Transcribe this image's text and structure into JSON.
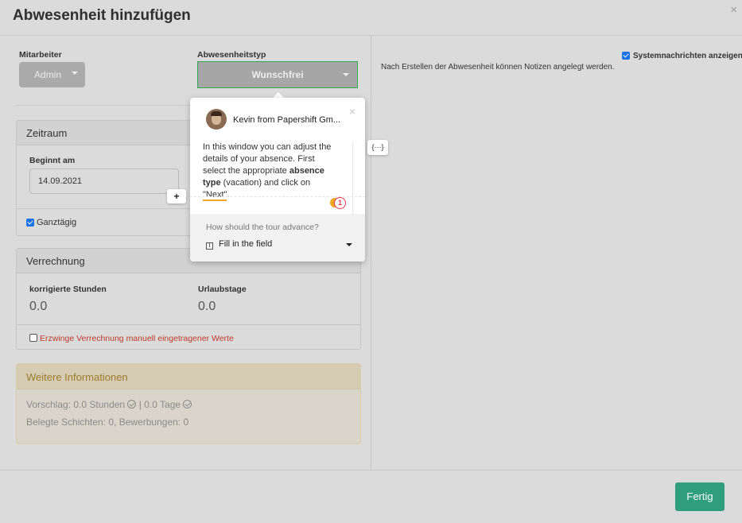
{
  "header": {
    "title": "Abwesenheit hinzufügen",
    "close": "×"
  },
  "left": {
    "employee": {
      "label": "Mitarbeiter",
      "value": "Admin"
    },
    "absence_type": {
      "label": "Abwesenheitstyp",
      "value": "Wunschfrei"
    },
    "zeitraum": {
      "title": "Zeitraum",
      "start_label": "Beginnt am",
      "start_value": "14.09.2021",
      "all_day_label": "Ganztägig",
      "all_day_checked": true
    },
    "verrechnung": {
      "title": "Verrechnung",
      "hours_label": "korrigierte Stunden",
      "hours_value": "0.0",
      "days_label": "Urlaubstage",
      "days_value": "0.0",
      "force_label": "Erzwinge Verrechnung manuell eingetragener Werte",
      "force_checked": false
    },
    "info": {
      "title": "Weitere Informationen",
      "suggestion_hours": "Vorschlag: 0.0 Stunden",
      "suggestion_sep": " | ",
      "suggestion_days": "0.0 Tage",
      "occupied": "Belegte Schichten: 0, Bewerbungen: 0"
    }
  },
  "right": {
    "system_msg_label": "Systemnachrichten anzeigen",
    "system_msg_checked": true,
    "note": "Nach Erstellen der Abwesenheit können Notizen angelegt werden."
  },
  "footer": {
    "done_label": "Fertig"
  },
  "tour": {
    "sender": "Kevin from Papershift Gm...",
    "close": "×",
    "text_1": "In this window you can adjust the details of your absence. First select the appropriate ",
    "text_bold": "absence type",
    "text_2": " (vacation) and click on ",
    "text_link": "\"Next\"",
    "text_3": ".",
    "badge_count": "1",
    "advance_question": "How should the tour advance?",
    "advance_value": "Fill in the field",
    "plus": "+",
    "code": "{···}"
  },
  "colors": {
    "accent_green": "#2f9e7c",
    "checkbox_blue": "#1a73e8",
    "warning_red": "#c0392b",
    "info_gold": "#9b7b2d"
  }
}
